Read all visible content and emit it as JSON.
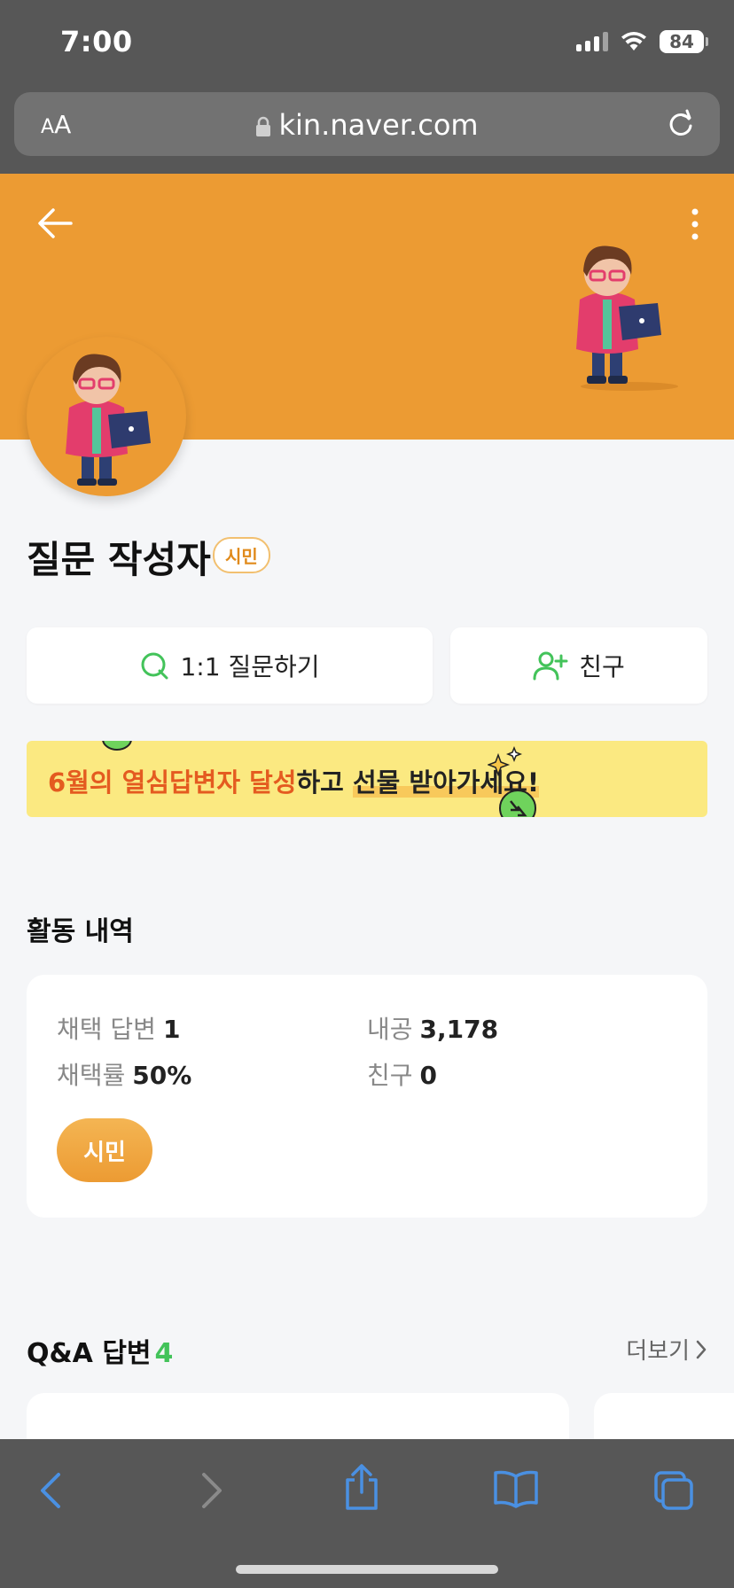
{
  "status_bar": {
    "time": "7:00",
    "battery": "84"
  },
  "browser": {
    "text_size_label_small": "A",
    "text_size_label_large": "A",
    "url": "kin.naver.com"
  },
  "profile": {
    "name": "질문 작성자",
    "grade_badge": "시민"
  },
  "actions": {
    "question_label": "1:1 질문하기",
    "friend_label": "친구"
  },
  "banner": {
    "highlight": "6월의 열심답변자 달성",
    "middle": "하고 ",
    "underline": "선물 받아가세요!"
  },
  "activity": {
    "title": "활동 내역",
    "stats": [
      {
        "label": "채택 답변",
        "value": "1"
      },
      {
        "label": "채택률",
        "value": "50%"
      },
      {
        "label": "내공",
        "value": "3,178"
      },
      {
        "label": "친구",
        "value": "0"
      }
    ],
    "grade": "시민"
  },
  "qa": {
    "title": "Q&A 답변",
    "count": "4",
    "more_label": "더보기"
  },
  "colors": {
    "header_orange": "#ec9b33",
    "accent_green": "#43c35a",
    "banner_yellow": "#fbe981"
  }
}
